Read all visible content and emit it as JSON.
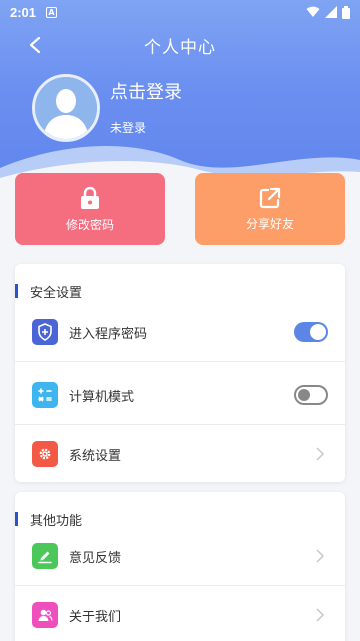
{
  "status": {
    "time": "2:01",
    "notification_glyph": "A"
  },
  "nav": {
    "title": "个人中心"
  },
  "profile": {
    "login_title": "点击登录",
    "login_status": "未登录"
  },
  "actions": [
    {
      "label": "修改密码",
      "icon": "lock-icon",
      "color": "#f56e80"
    },
    {
      "label": "分享好友",
      "icon": "share-icon",
      "color": "#fd9e68"
    }
  ],
  "security": {
    "title": "安全设置",
    "items": [
      {
        "label": "进入程序密码",
        "icon": "shield-icon",
        "icon_color": "#4a66d6",
        "control": "toggle",
        "checked": true
      },
      {
        "label": "计算机模式",
        "icon": "calculator-icon",
        "icon_color": "#3fb5f0",
        "control": "toggle",
        "checked": false
      },
      {
        "label": "系统设置",
        "icon": "settings-gear-icon",
        "icon_color": "#f25a45",
        "control": "chevron"
      }
    ]
  },
  "other": {
    "title": "其他功能",
    "items": [
      {
        "label": "意见反馈",
        "icon": "edit-feedback-icon",
        "icon_color": "#4cc75a",
        "control": "chevron"
      },
      {
        "label": "关于我们",
        "icon": "about-users-icon",
        "icon_color": "#ef4fbd",
        "control": "chevron"
      }
    ]
  },
  "colors": {
    "header": "#6b8ff0",
    "accent": "#2a55c9"
  }
}
